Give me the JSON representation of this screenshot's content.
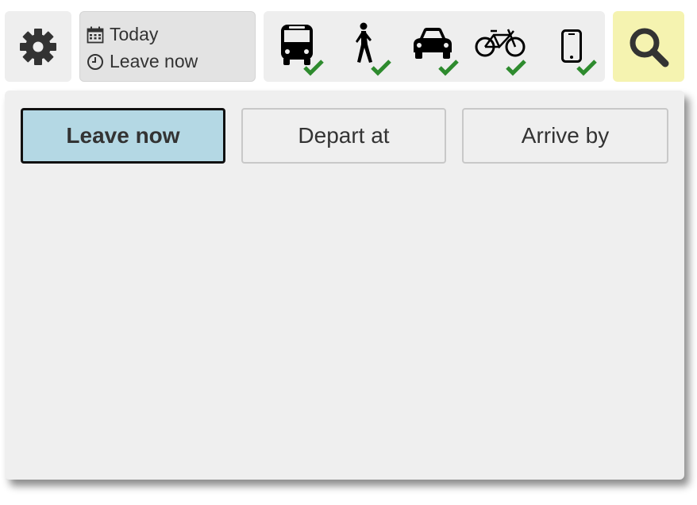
{
  "toolbar": {
    "settings_icon": "gear-icon",
    "datetime": {
      "date_icon": "calendar-icon",
      "date_label": "Today",
      "time_icon": "clock-icon",
      "time_label": "Leave now"
    },
    "modes": [
      {
        "name": "bus",
        "icon": "bus-icon",
        "checked": true
      },
      {
        "name": "walk",
        "icon": "walk-icon",
        "checked": true
      },
      {
        "name": "car",
        "icon": "car-icon",
        "checked": true
      },
      {
        "name": "bicycle",
        "icon": "bicycle-icon",
        "checked": true
      },
      {
        "name": "phone",
        "icon": "phone-icon",
        "checked": true
      }
    ],
    "search_icon": "search-icon"
  },
  "time_options": {
    "leave_now": "Leave now",
    "depart_at": "Depart at",
    "arrive_by": "Arrive by",
    "selected": "Leave now"
  },
  "colors": {
    "selected_bg": "#b4d8e4",
    "search_bg": "#f5f3b0",
    "check": "#2e8b2e",
    "panel_bg": "#efefef"
  }
}
